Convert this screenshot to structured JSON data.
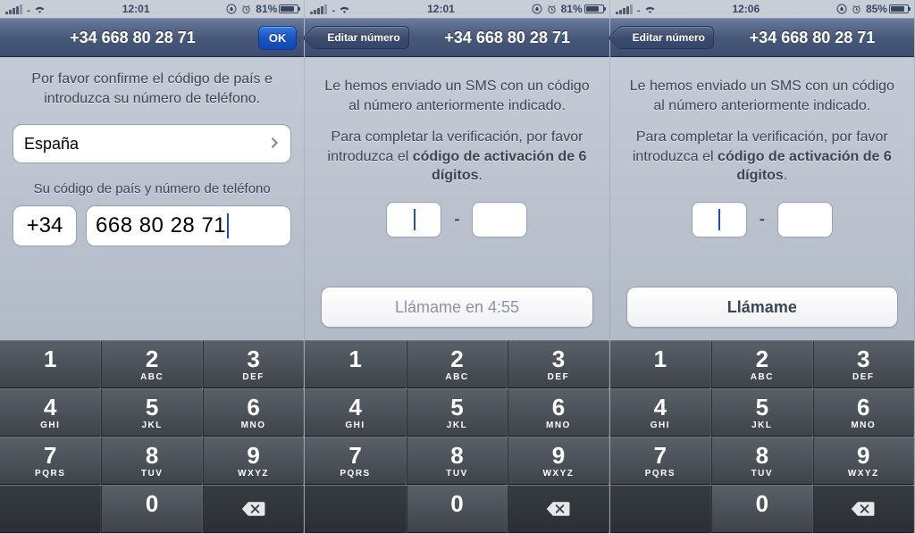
{
  "status": {
    "carrier": "",
    "battery_a": "81%",
    "battery_c": "85%",
    "time_a": "12:01",
    "time_c": "12:06",
    "fill_a": 81,
    "fill_c": 85
  },
  "keypad": [
    {
      "d": "1",
      "l": ""
    },
    {
      "d": "2",
      "l": "ABC"
    },
    {
      "d": "3",
      "l": "DEF"
    },
    {
      "d": "4",
      "l": "GHI"
    },
    {
      "d": "5",
      "l": "JKL"
    },
    {
      "d": "6",
      "l": "MNO"
    },
    {
      "d": "7",
      "l": "PQRS"
    },
    {
      "d": "8",
      "l": "TUV"
    },
    {
      "d": "9",
      "l": "WXYZ"
    },
    {
      "d": "",
      "l": ""
    },
    {
      "d": "0",
      "l": ""
    },
    {
      "d": "⌫",
      "l": ""
    }
  ],
  "s1": {
    "title": "+34 668 80 28 71",
    "ok": "OK",
    "instr": "Por favor confirme el código de país e introduzca su número de teléfono.",
    "country": "España",
    "sublabel": "Su código de país y número de teléfono",
    "code": "+34",
    "number": "668 80 28 71"
  },
  "s2": {
    "back": "Editar número",
    "title": "+34 668 80 28 71",
    "line1": "Le hemos enviado un SMS con un código al número anteriormente indicado.",
    "line2a": "Para completar la verificación, por favor introduzca el ",
    "line2b": "código de activación de 6 dígitos",
    "line2c": ".",
    "dash": "-",
    "call": "Llámame en 4:55"
  },
  "s3": {
    "back": "Editar número",
    "title": "+34 668 80 28 71",
    "line1": "Le hemos enviado un SMS con un código al número anteriormente indicado.",
    "line2a": "Para completar la verificación, por favor introduzca el ",
    "line2b": "código de activación de 6 dígitos",
    "line2c": ".",
    "dash": "-",
    "call": "Llámame"
  }
}
